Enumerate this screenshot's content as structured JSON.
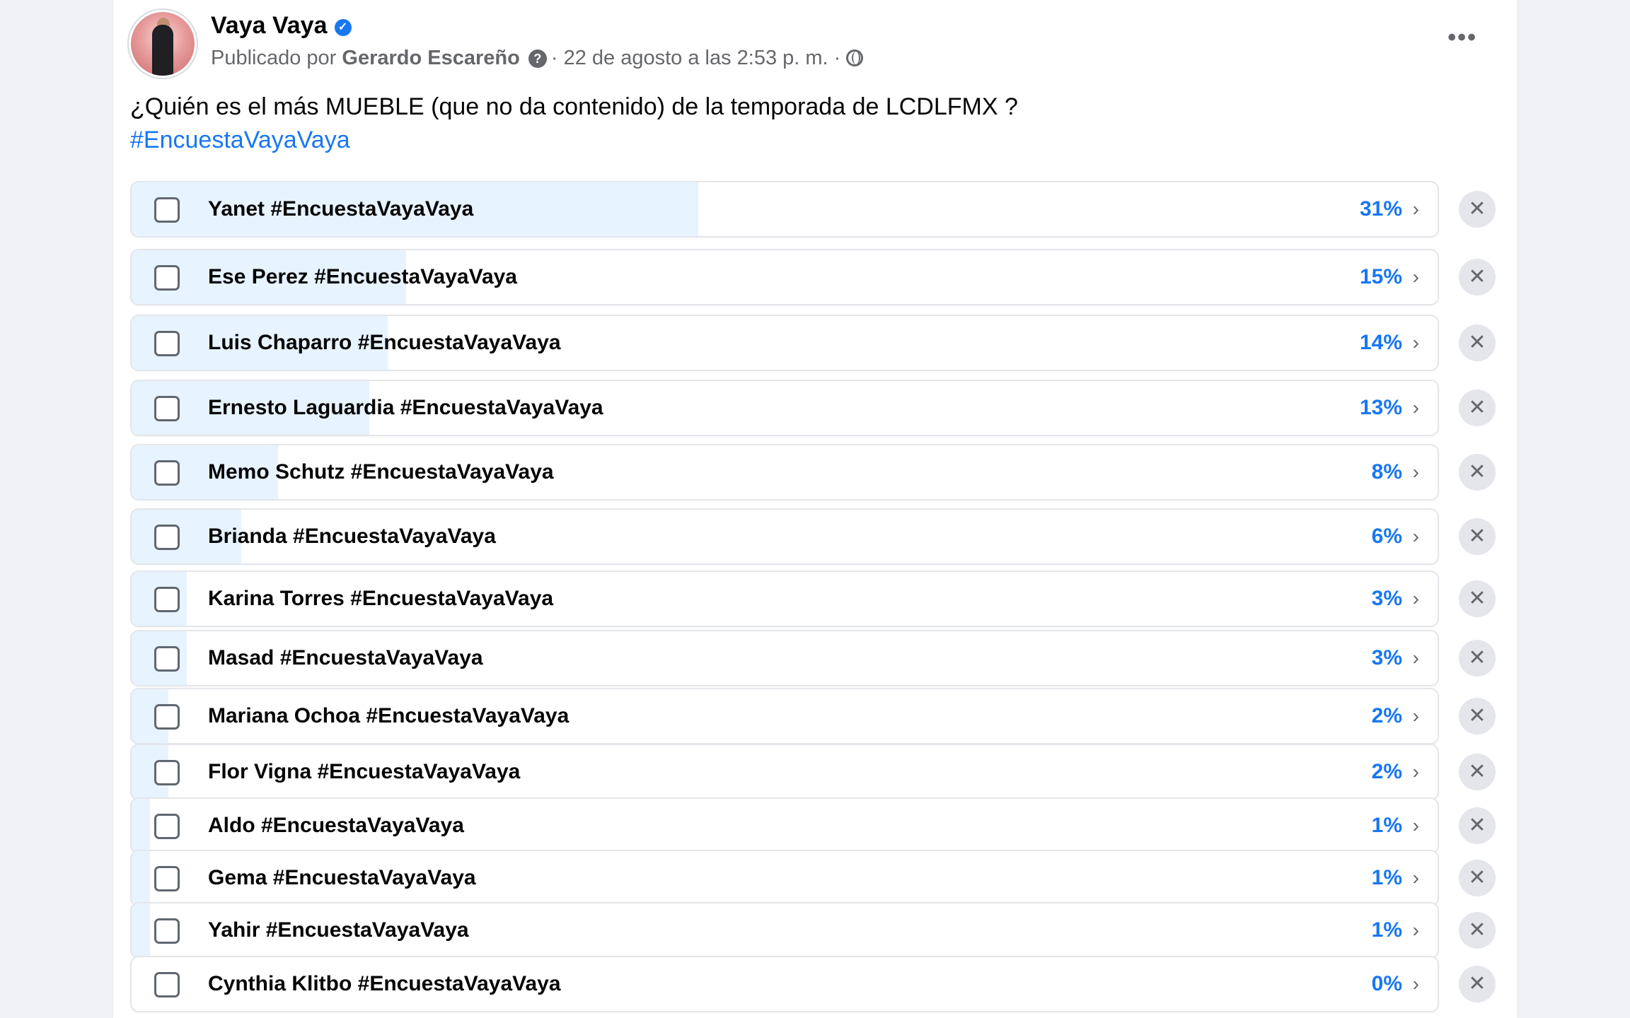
{
  "post": {
    "page_name": "Vaya Vaya",
    "published_by_prefix": "Publicado por",
    "author": "Gerardo Escareño",
    "date_text": "· 22 de agosto a las 2:53 p. m. ·",
    "question": "¿Quién es el más MUEBLE (que no da contenido) de la temporada de LCDLFMX ?",
    "hashtag": "#EncuestaVayaVaya",
    "more_label": "•••"
  },
  "icons": {
    "verified": "verified-badge-icon",
    "help": "question-circle-icon",
    "globe": "globe-icon",
    "more": "more-horizontal-icon",
    "checkbox": "checkbox-icon",
    "chevron": "chevron-right-icon",
    "remove": "close-icon"
  },
  "colors": {
    "accent": "#1877f2",
    "fill": "#e7f3ff",
    "muted": "#65676b"
  },
  "poll": {
    "chevron": "›",
    "remove": "✕",
    "options": [
      {
        "label": "Yanet #EncuestaVayaVaya",
        "pct_text": "31%",
        "pct": 31
      },
      {
        "label": "Ese Perez #EncuestaVayaVaya",
        "pct_text": "15%",
        "pct": 15
      },
      {
        "label": "Luis Chaparro #EncuestaVayaVaya",
        "pct_text": "14%",
        "pct": 14
      },
      {
        "label": "Ernesto Laguardia #EncuestaVayaVaya",
        "pct_text": "13%",
        "pct": 13
      },
      {
        "label": "Memo Schutz #EncuestaVayaVaya",
        "pct_text": "8%",
        "pct": 8
      },
      {
        "label": "Brianda #EncuestaVayaVaya",
        "pct_text": "6%",
        "pct": 6
      },
      {
        "label": "Karina Torres #EncuestaVayaVaya",
        "pct_text": "3%",
        "pct": 3
      },
      {
        "label": "Masad #EncuestaVayaVaya",
        "pct_text": "3%",
        "pct": 3
      },
      {
        "label": "Mariana Ochoa #EncuestaVayaVaya",
        "pct_text": "2%",
        "pct": 2
      },
      {
        "label": "Flor Vigna #EncuestaVayaVaya",
        "pct_text": "2%",
        "pct": 2
      },
      {
        "label": "Aldo #EncuestaVayaVaya",
        "pct_text": "1%",
        "pct": 1
      },
      {
        "label": "Gema #EncuestaVayaVaya",
        "pct_text": "1%",
        "pct": 1
      },
      {
        "label": "Yahir #EncuestaVayaVaya",
        "pct_text": "1%",
        "pct": 1
      },
      {
        "label": "Cynthia Klitbo #EncuestaVayaVaya",
        "pct_text": "0%",
        "pct": 0
      }
    ]
  }
}
